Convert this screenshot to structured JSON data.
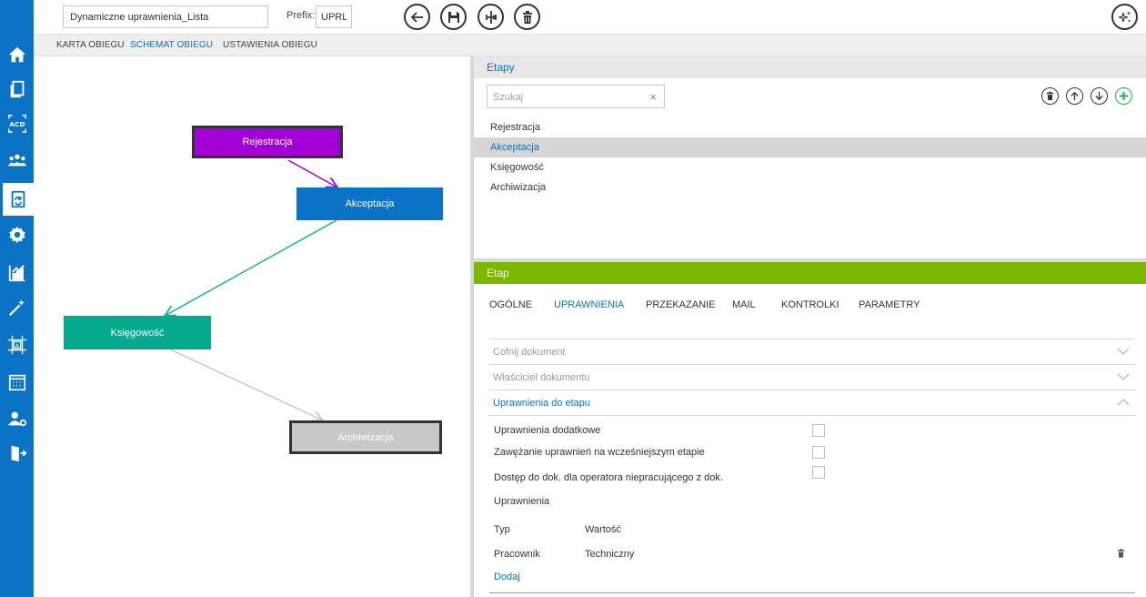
{
  "toolbar": {
    "document_name": "Dynamiczne uprawnienia_Lista",
    "prefix_label": "Prefix:",
    "prefix_value": "UPRL"
  },
  "sidebar": {
    "items": [
      {
        "icon": "home-icon"
      },
      {
        "icon": "documents-icon"
      },
      {
        "icon": "ocr-acd-icon"
      },
      {
        "icon": "users-group-icon"
      },
      {
        "icon": "workflow-document-icon",
        "active": true
      },
      {
        "icon": "gear-icon"
      },
      {
        "icon": "chart-icon"
      },
      {
        "icon": "magic-wand-icon"
      },
      {
        "icon": "template-icon"
      },
      {
        "icon": "calendar-icon"
      },
      {
        "icon": "user-settings-icon"
      },
      {
        "icon": "logout-icon"
      }
    ]
  },
  "tabs": [
    {
      "label": "KARTA OBIEGU"
    },
    {
      "label": "SCHEMAT OBIEGU",
      "active": true
    },
    {
      "label": "USTAWIENIA OBIEGU"
    }
  ],
  "diagram": {
    "nodes": [
      {
        "label": "Rejestracja",
        "color": "#a200d6"
      },
      {
        "label": "Akceptacja",
        "color": "#0a73c6"
      },
      {
        "label": "Księgowość",
        "color": "#05a98e"
      },
      {
        "label": "Archiwizacja",
        "color": "#c8c8c8"
      }
    ]
  },
  "etapy": {
    "title": "Etapy",
    "search_placeholder": "Szukaj",
    "clear": "×",
    "items": [
      "Rejestracja",
      "Akceptacja",
      "Księgowość",
      "Archiwizacja"
    ],
    "selected": "Akceptacja"
  },
  "etap": {
    "title": "Etap",
    "tabs": [
      "OGÓLNE",
      "UPRAWNIENIA",
      "PRZEKAZANIE",
      "MAIL",
      "KONTROLKI",
      "PARAMETRY"
    ],
    "active_tab": "UPRAWNIENIA",
    "sections": [
      {
        "label": "Cofnij dokument",
        "open": false
      },
      {
        "label": "Właściciel dokumentu",
        "open": false
      },
      {
        "label": "Uprawnienia do etapu",
        "open": true
      }
    ],
    "checkboxes": [
      {
        "label": "Uprawnienia dodatkowe",
        "checked": false
      },
      {
        "label": "Zawężanie uprawnień na wcześniejszym etapie",
        "checked": false
      },
      {
        "label": "Dostęp do dok. dla operatora niepracującego z dok.",
        "checked": false
      }
    ],
    "permissions_label": "Uprawnienia",
    "table": {
      "headers": [
        "Typ",
        "Wartość"
      ],
      "rows": [
        [
          "Pracownik",
          "Techniczny"
        ]
      ]
    },
    "add_link": "Dodaj"
  }
}
